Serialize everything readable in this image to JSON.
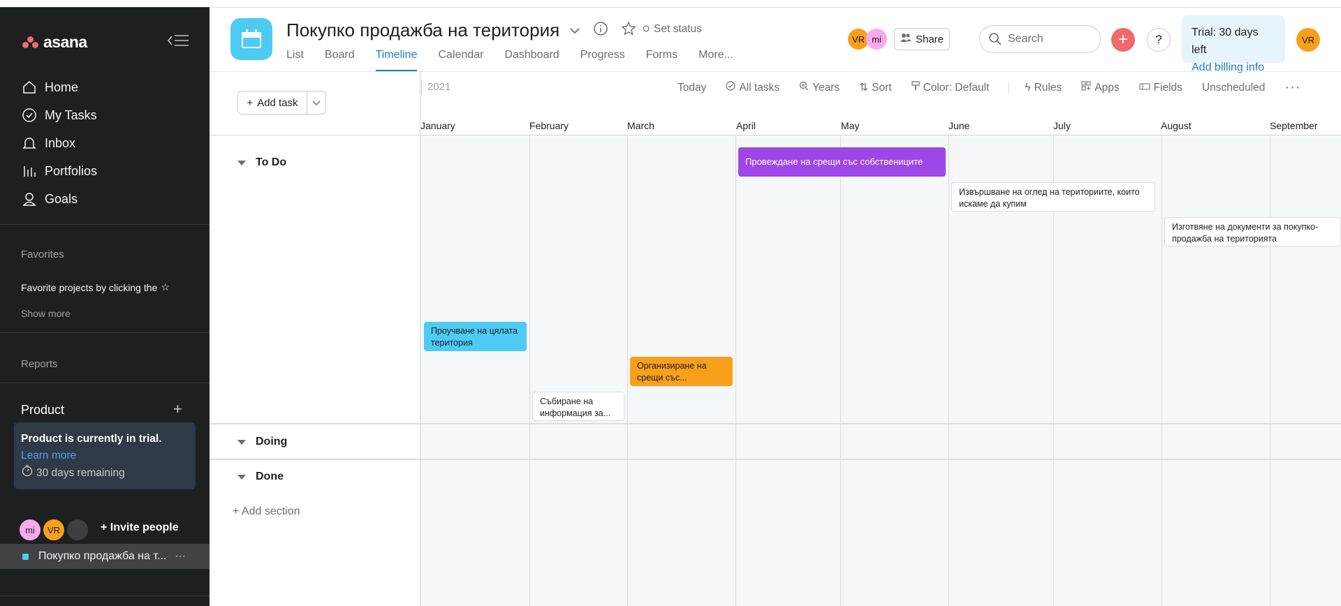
{
  "sidebar": {
    "logo": "asana",
    "nav": [
      {
        "label": "Home",
        "icon": "home-icon"
      },
      {
        "label": "My Tasks",
        "icon": "check-circle-icon"
      },
      {
        "label": "Inbox",
        "icon": "bell-icon"
      },
      {
        "label": "Portfolios",
        "icon": "bar-chart-icon"
      },
      {
        "label": "Goals",
        "icon": "person-icon"
      }
    ],
    "favorites_heading": "Favorites",
    "favorites_text": "Favorite projects by clicking the",
    "show_more": "Show more",
    "reports": "Reports",
    "team": "Product",
    "trial": {
      "text": "Product is currently in trial.",
      "link": "Learn more",
      "remaining": "30 days remaining"
    },
    "members": [
      "mi",
      "VR",
      ""
    ],
    "invite": "Invite people",
    "project": "Покупко продажба на т..."
  },
  "header": {
    "title": "Покупко продажба на територия",
    "set_status": "Set status",
    "tabs": [
      "List",
      "Board",
      "Timeline",
      "Calendar",
      "Dashboard",
      "Progress",
      "Forms",
      "More..."
    ],
    "active_tab": "Timeline",
    "avatars": [
      "VR",
      "mi"
    ],
    "share": "Share",
    "search_placeholder": "Search",
    "trial_line1": "Trial: 30 days left",
    "trial_line2": "Add billing info",
    "user_avatar": "VR"
  },
  "toolbar": {
    "add_task": "Add task",
    "year": "2021",
    "today": "Today",
    "all_tasks": "All tasks",
    "years": "Years",
    "sort": "Sort",
    "color": "Color: Default",
    "rules": "Rules",
    "apps": "Apps",
    "fields": "Fields",
    "unscheduled": "Unscheduled"
  },
  "timeline": {
    "months": [
      "January",
      "February",
      "March",
      "April",
      "May",
      "June",
      "July",
      "August",
      "September"
    ],
    "sections": [
      "To Do",
      "Doing",
      "Done"
    ],
    "add_section": "+ Add section",
    "tasks": [
      {
        "name": "Провеждане на срещи със собствениците",
        "color": "#9e47e6"
      },
      {
        "name": "Извършване на оглед на териториите, които искаме да купим",
        "color": "#ffffff"
      },
      {
        "name": "Изготвяне на документи за покупко-продажба на територията",
        "color": "#ffffff"
      },
      {
        "name": "Проучване на цялата територия",
        "color": "#4ecbf3"
      },
      {
        "name": "Организиране на срещи със...",
        "color": "#f8a01b"
      },
      {
        "name": "Събиране на информация за...",
        "color": "#ffffff"
      }
    ]
  }
}
